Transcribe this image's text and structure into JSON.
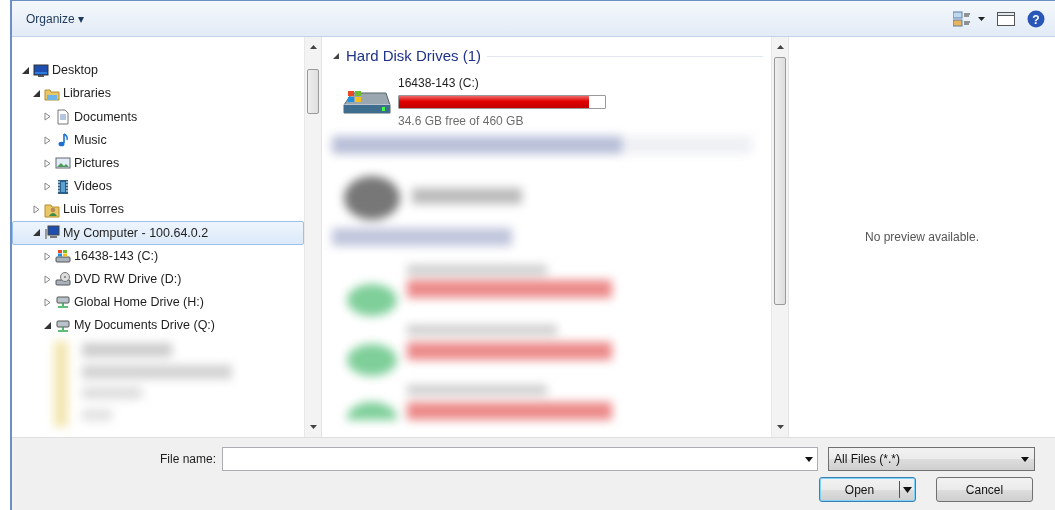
{
  "toolbar": {
    "organize": "Organize ▾",
    "help": "?"
  },
  "tree": [
    {
      "label": "Desktop",
      "kind": "desktop",
      "expanded": true,
      "selected": false,
      "children": [
        {
          "label": "Libraries",
          "kind": "library",
          "expanded": true,
          "selected": false,
          "children": [
            {
              "label": "Documents",
              "kind": "documents",
              "expanded": false,
              "selected": false
            },
            {
              "label": "Music",
              "kind": "music",
              "expanded": false,
              "selected": false
            },
            {
              "label": "Pictures",
              "kind": "pictures",
              "expanded": false,
              "selected": false
            },
            {
              "label": "Videos",
              "kind": "videos",
              "expanded": false,
              "selected": false
            }
          ]
        },
        {
          "label": "Luis Torres",
          "kind": "user",
          "expanded": false,
          "selected": false
        },
        {
          "label": "My Computer - 100.64.0.2",
          "kind": "computer",
          "expanded": true,
          "selected": true,
          "children": [
            {
              "label": "16438-143 (C:)",
              "kind": "system-drive",
              "expanded": false,
              "selected": false
            },
            {
              "label": "DVD RW Drive (D:)",
              "kind": "dvd",
              "expanded": false,
              "selected": false
            },
            {
              "label": "Global Home Drive (H:)",
              "kind": "network-drive",
              "expanded": false,
              "selected": false
            },
            {
              "label": "My Documents Drive (Q:)",
              "kind": "network-drive",
              "expanded": true,
              "selected": false
            }
          ]
        }
      ]
    }
  ],
  "content": {
    "group": {
      "title": "Hard Disk Drives (1)",
      "expanded": true
    },
    "drives": [
      {
        "name": "16438-143 (C:)",
        "level": 0.92,
        "free": "34.6 GB free of 460 GB"
      }
    ]
  },
  "preview": {
    "message": "No preview available."
  },
  "footer": {
    "file_name_label": "File name:",
    "file_type": "All Files (*.*)",
    "open": "Open",
    "cancel": "Cancel"
  }
}
